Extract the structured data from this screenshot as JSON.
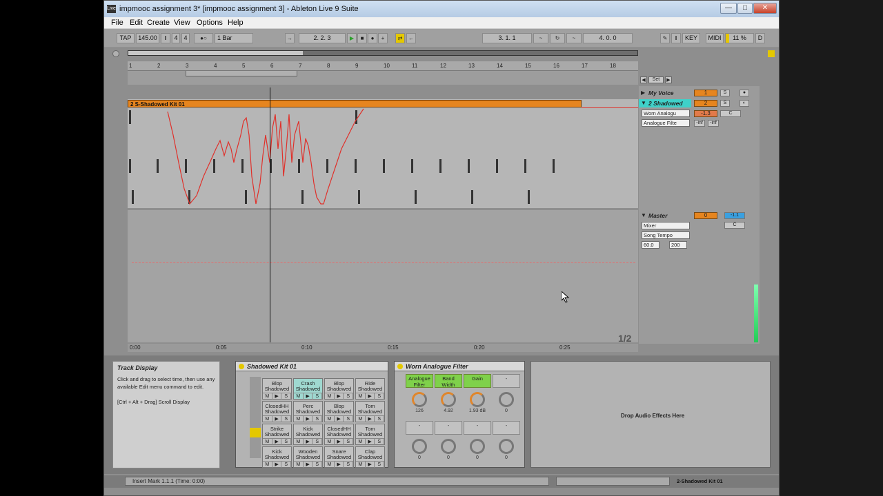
{
  "window": {
    "title": "impmooc assignment 3*  [impmooc assignment 3] - Ableton Live 9 Suite",
    "icon": "Live",
    "minimize": "—",
    "maximize": "□",
    "close": "✕"
  },
  "menu": [
    "File",
    "Edit",
    "Create",
    "View",
    "Options",
    "Help"
  ],
  "transport": {
    "tap": "TAP",
    "tempo": "145.00",
    "signature_num": "4",
    "signature_den": "4",
    "quantize": "1 Bar",
    "position": "2.  2.  3",
    "loop_start": "3.  1.  1",
    "loop_length": "4.  0.  0",
    "key": "KEY",
    "midi": "MIDI",
    "cpu": "11 %",
    "disk": "D"
  },
  "ruler": [
    "1",
    "2",
    "3",
    "4",
    "5",
    "6",
    "7",
    "8",
    "9",
    "10",
    "11",
    "12",
    "13",
    "14",
    "15",
    "16",
    "17",
    "18"
  ],
  "time_ruler": [
    "0:00",
    "0:05",
    "0:10",
    "0:15",
    "0:20",
    "0:25"
  ],
  "clip": {
    "name": "2 S-Shadowed Kit 01"
  },
  "set_label": "Set",
  "tracks": [
    {
      "name": "My Voice",
      "number": "1",
      "solo": "S"
    },
    {
      "name": "2 Shadowed",
      "number": "2",
      "solo": "S",
      "device1": "Worn Analogu",
      "device2": "Analogue Filte",
      "volume": "-1.3",
      "pan": "C",
      "send1": "-inf",
      "send2": "-inf"
    }
  ],
  "master": {
    "name": "Master",
    "number": "0",
    "chooser": "Mixer",
    "param": "Song Tempo",
    "min": "60.0",
    "max": "200",
    "pan": "C",
    "volume": "-1.1"
  },
  "pager": "1/2",
  "info": {
    "title": "Track Display",
    "body": "Click and drag to select time, then use any available Edit menu command to edit.\n\n[Ctrl + Alt + Drag] Scroll Display"
  },
  "drum_rack": {
    "title": "Shadowed Kit 01",
    "pads": [
      "Kick\nShadowed",
      "Wooden\nShadowed",
      "Snare\nShadowed",
      "Clap\nShadowed",
      "Strike\nShadowed",
      "Kick\nShadowed",
      "ClosedHH\nShadowed",
      "Tom\nShadowed",
      "ClosedHH\nShadowed",
      "Perc\nShadowed",
      "Blop\nShadowed",
      "Tom\nShadowed",
      "Blop\nShadowed",
      "Crash\nShadowed",
      "Blop\nShadowed",
      "Ride\nShadowed"
    ],
    "m": "M",
    "play": "▶",
    "s": "S"
  },
  "filter": {
    "title": "Worn Analogue Filter",
    "knobs": [
      {
        "label": "Analogue\nFilter",
        "value": "126"
      },
      {
        "label": "Band\nWidth",
        "value": "4.92"
      },
      {
        "label": "Gain",
        "value": "1.93 dB"
      },
      {
        "label": "-",
        "value": "0"
      }
    ],
    "knobs2": [
      {
        "label": "-",
        "value": "0"
      },
      {
        "label": "-",
        "value": "0"
      },
      {
        "label": "-",
        "value": "0"
      },
      {
        "label": "-",
        "value": "0"
      }
    ]
  },
  "drop_text": "Drop Audio Effects Here",
  "status": {
    "message": "Insert Mark 1.1.1 (Time: 0:00)",
    "clip": "2-Shadowed Kit 01"
  }
}
